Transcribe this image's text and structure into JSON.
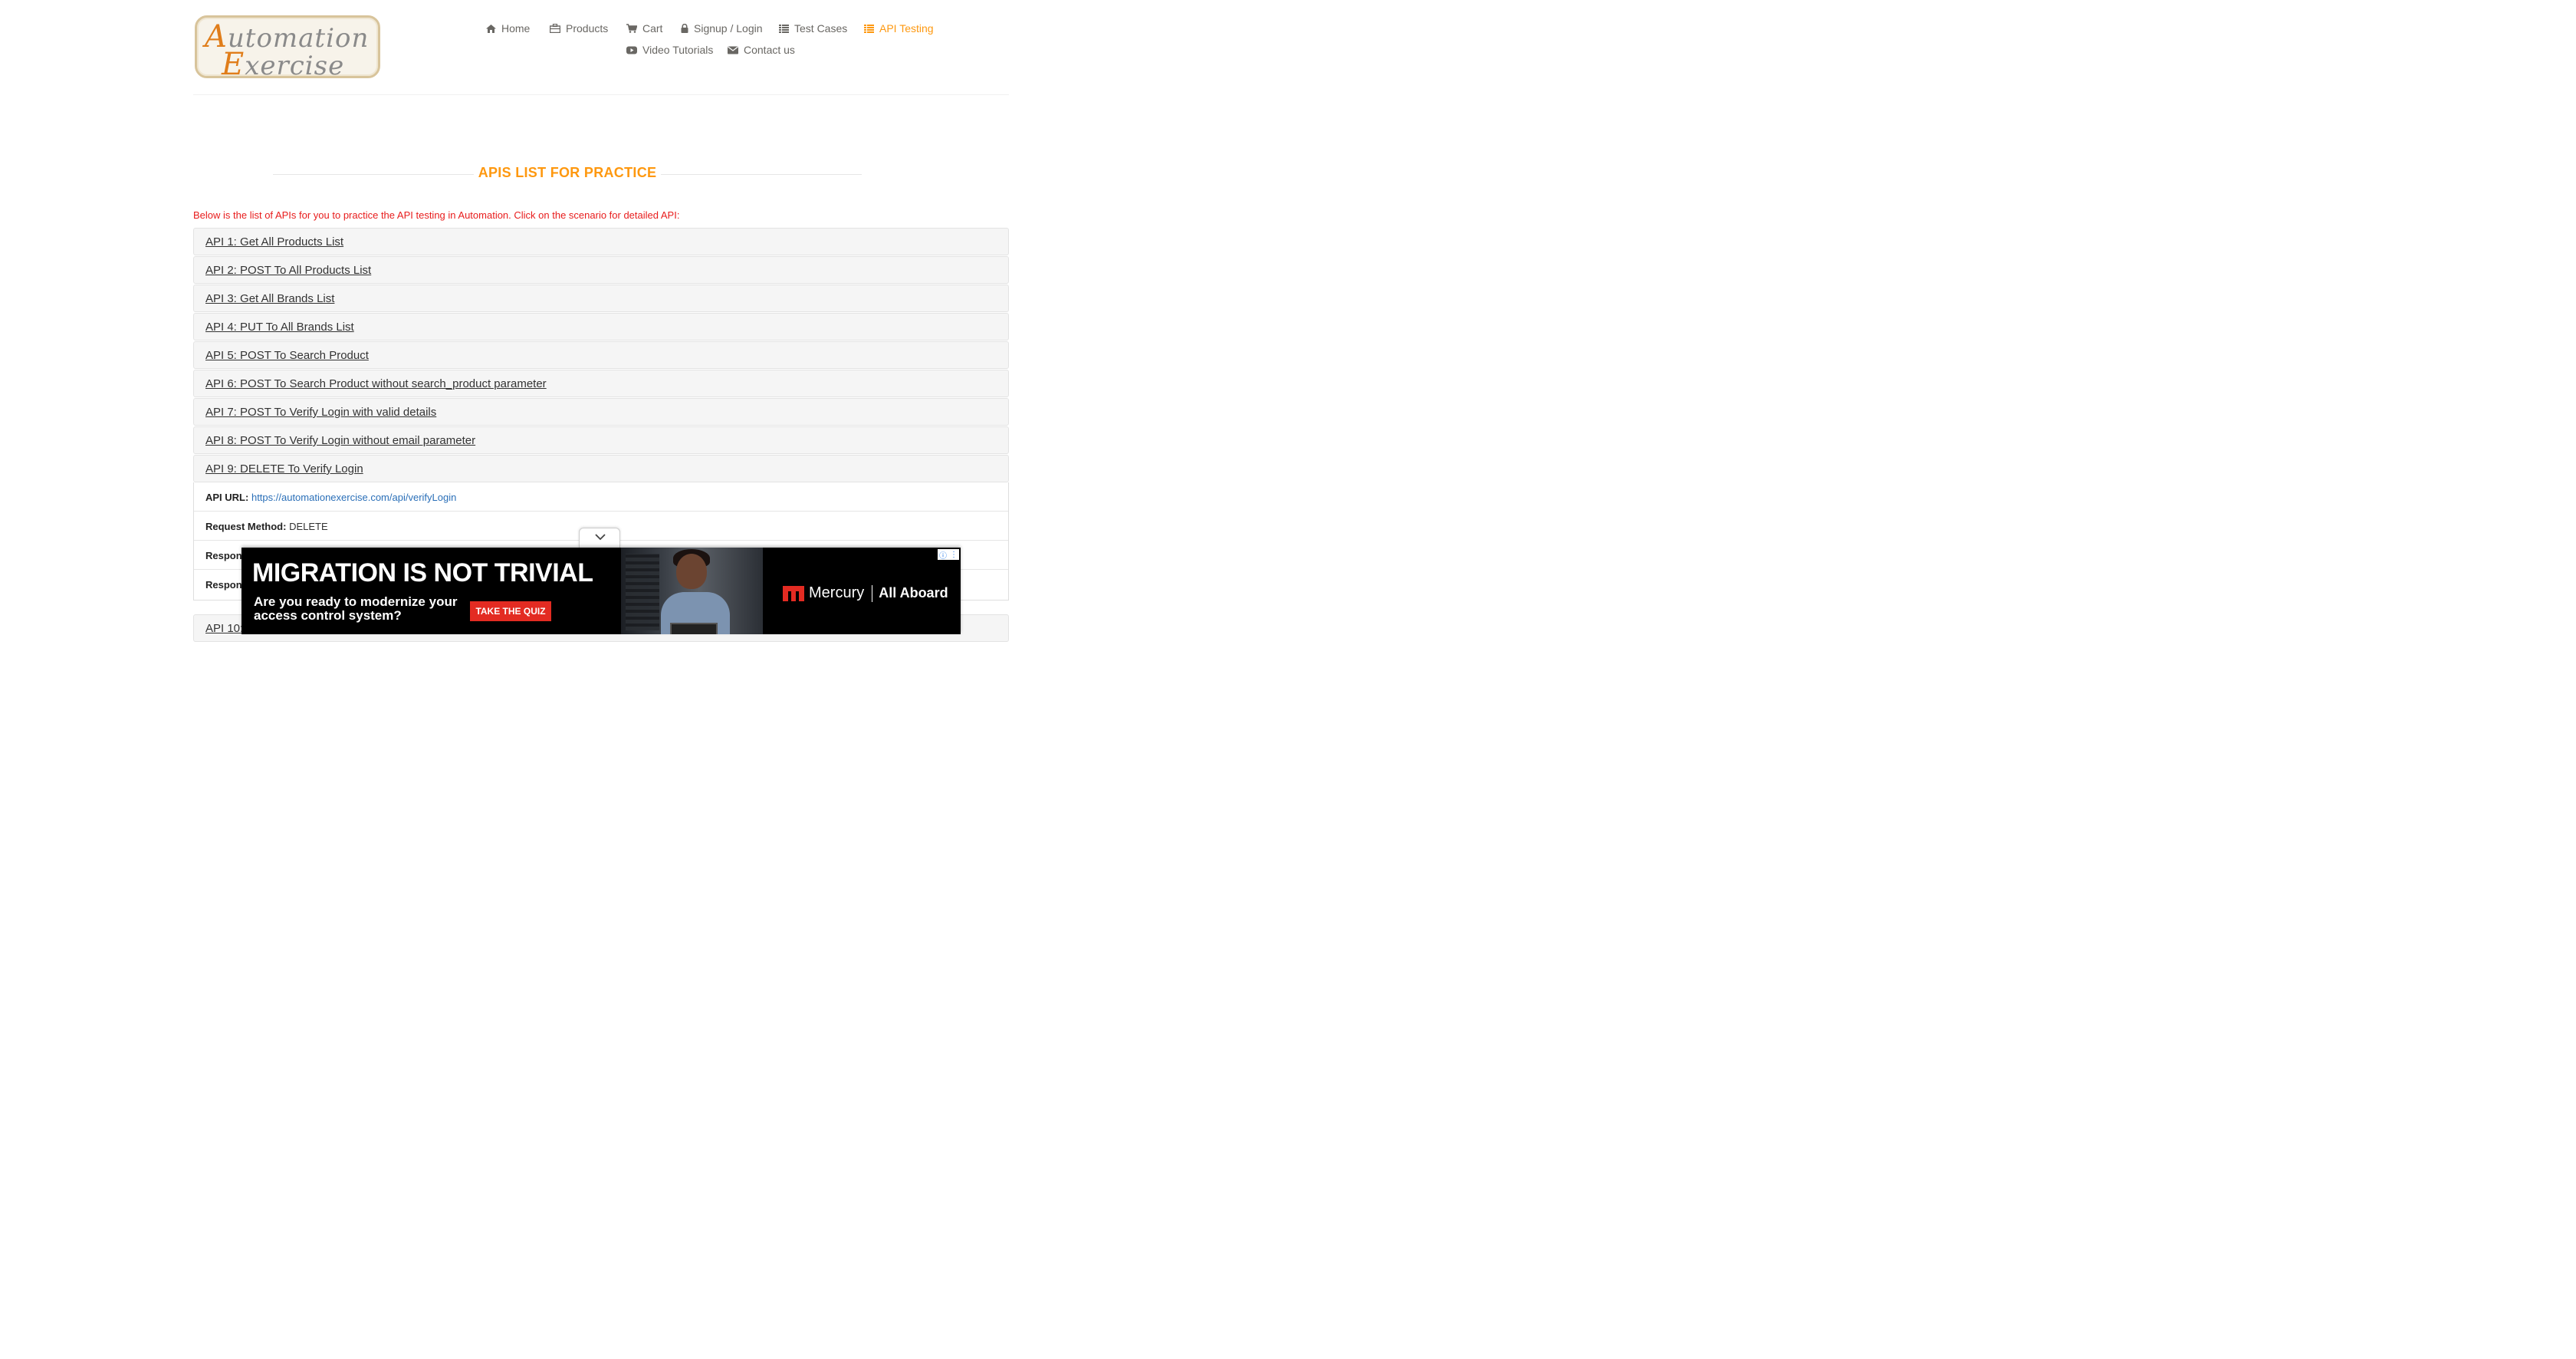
{
  "logo": {
    "line1": "Automation",
    "line2": "Exercise"
  },
  "nav": [
    {
      "label": "Home",
      "icon": "home-icon"
    },
    {
      "label": "Products",
      "icon": "products-icon"
    },
    {
      "label": "Cart",
      "icon": "cart-icon"
    },
    {
      "label": "Signup / Login",
      "icon": "lock-icon"
    },
    {
      "label": "Test Cases",
      "icon": "list-icon"
    },
    {
      "label": "API Testing",
      "icon": "list-icon",
      "active": true
    },
    {
      "label": "Video Tutorials",
      "icon": "youtube-icon"
    },
    {
      "label": "Contact us",
      "icon": "envelope-icon"
    }
  ],
  "colors": {
    "accent": "#fe980f",
    "intro": "#e81c1c",
    "link": "#2a6fb8"
  },
  "section_title": "APIS LIST FOR PRACTICE",
  "intro_text": "Below is the list of APIs for you to practice the API testing in Automation. Click on the scenario for detailed API:",
  "apis": [
    "API 1: Get All Products List",
    "API 2: POST To All Products List",
    "API 3: Get All Brands List",
    "API 4: PUT To All Brands List",
    "API 5: POST To Search Product",
    "API 6: POST To Search Product without search_product parameter",
    "API 7: POST To Verify Login with valid details",
    "API 8: POST To Verify Login without email parameter",
    "API 9: DELETE To Verify Login",
    "API 10:"
  ],
  "api9_details": {
    "url_label": "API URL:",
    "url": "https://automationexercise.com/api/verifyLogin",
    "method_label": "Request Method:",
    "method": "DELETE",
    "response_code_label": "Respon",
    "response_message_label": "Respon"
  },
  "ad": {
    "headline": "MIGRATION IS NOT TRIVIAL",
    "subline": "Are you ready to modernize your access control system?",
    "cta": "TAKE THE QUIZ",
    "brand": "Mercury",
    "tagline": "All Aboard"
  }
}
